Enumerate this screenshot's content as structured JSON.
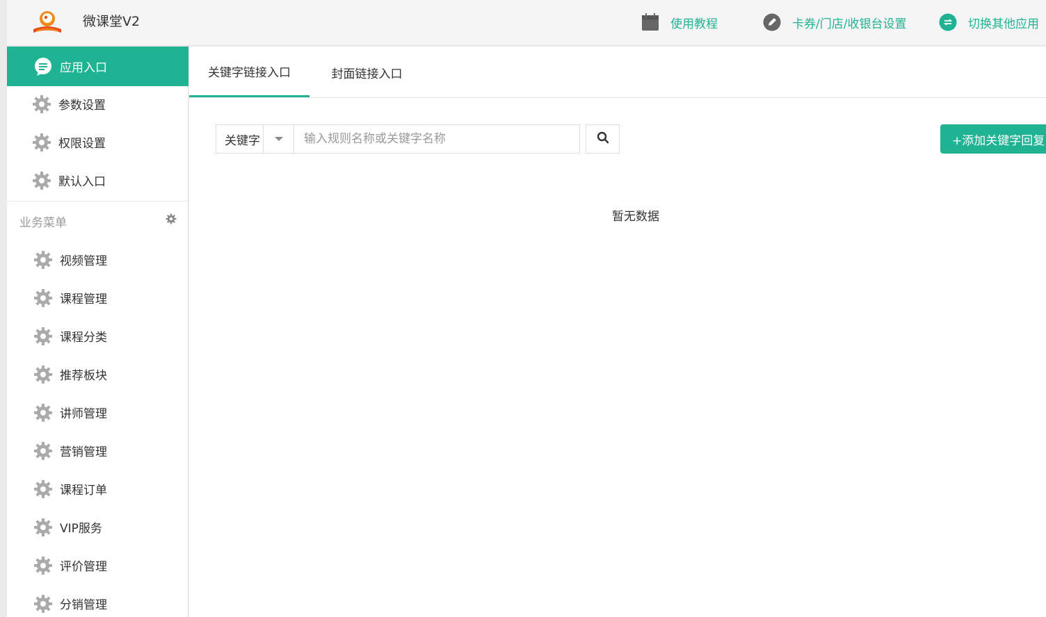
{
  "header": {
    "app_title": "微课堂V2",
    "tutorial_label": "使用教程",
    "settings_label": "卡券/门店/收银台设置",
    "switch_label": "切换其他应用",
    "accent_color": "#1fb393"
  },
  "sidebar": {
    "top_items": [
      {
        "label": "应用入口",
        "icon": "chat-bubble-icon",
        "active": true
      },
      {
        "label": "参数设置",
        "icon": "gear-icon"
      },
      {
        "label": "权限设置",
        "icon": "gear-icon"
      },
      {
        "label": "默认入口",
        "icon": "gear-icon"
      }
    ],
    "section_title": "业务菜单",
    "business_items": [
      {
        "label": "视频管理",
        "icon": "gear-icon"
      },
      {
        "label": "课程管理",
        "icon": "gear-icon"
      },
      {
        "label": "课程分类",
        "icon": "gear-icon"
      },
      {
        "label": "推荐板块",
        "icon": "gear-icon"
      },
      {
        "label": "讲师管理",
        "icon": "gear-icon"
      },
      {
        "label": "营销管理",
        "icon": "gear-icon"
      },
      {
        "label": "课程订单",
        "icon": "gear-icon"
      },
      {
        "label": "VIP服务",
        "icon": "gear-icon"
      },
      {
        "label": "评价管理",
        "icon": "gear-icon"
      },
      {
        "label": "分销管理",
        "icon": "gear-icon"
      }
    ]
  },
  "main": {
    "tabs": [
      {
        "label": "关键字链接入口",
        "active": true
      },
      {
        "label": "封面链接入口",
        "active": false
      }
    ],
    "filter": {
      "selected": "关键字",
      "search_placeholder": "输入规则名称或关键字名称",
      "search_value": ""
    },
    "add_button_label": "+添加关键字回复",
    "empty_text": "暂无数据"
  }
}
